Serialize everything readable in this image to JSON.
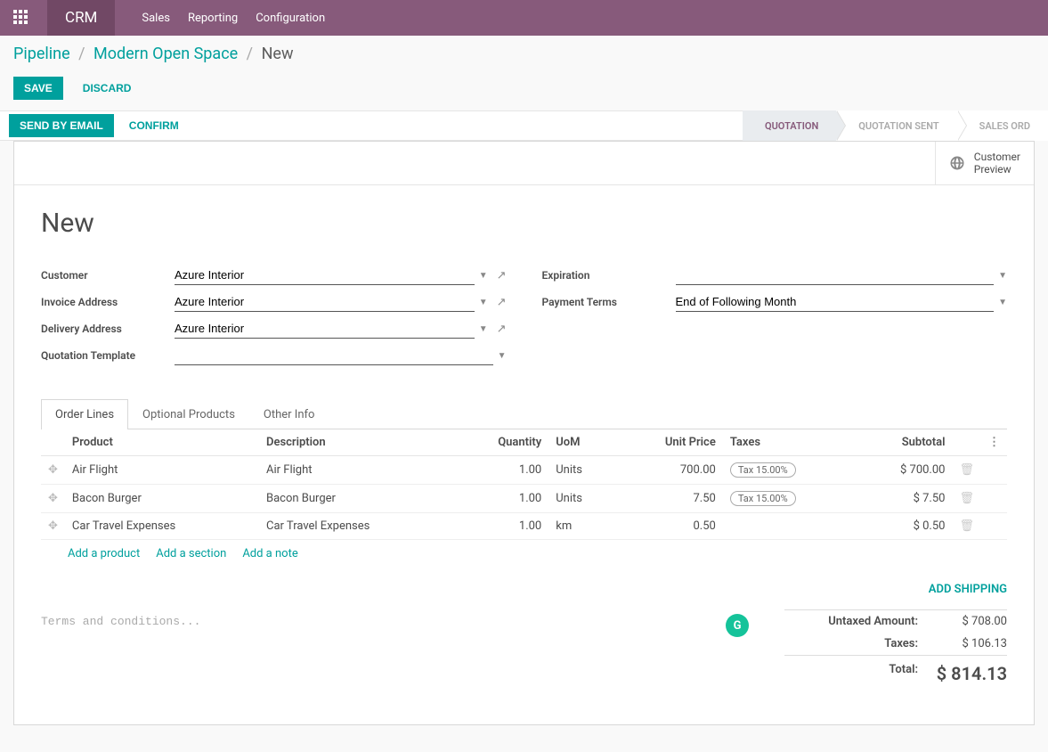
{
  "topbar": {
    "app": "CRM",
    "nav": [
      "Sales",
      "Reporting",
      "Configuration"
    ]
  },
  "breadcrumb": {
    "items": [
      "Pipeline",
      "Modern Open Space"
    ],
    "current": "New"
  },
  "actions": {
    "save": "SAVE",
    "discard": "DISCARD"
  },
  "statusbar": {
    "send": "SEND BY EMAIL",
    "confirm": "CONFIRM",
    "steps": [
      "QUOTATION",
      "QUOTATION SENT",
      "SALES ORD"
    ]
  },
  "preview": "Customer\nPreview",
  "title": "New",
  "form": {
    "customer_label": "Customer",
    "customer": "Azure Interior",
    "invoice_label": "Invoice Address",
    "invoice": "Azure Interior",
    "delivery_label": "Delivery Address",
    "delivery": "Azure Interior",
    "template_label": "Quotation Template",
    "template": "",
    "expiration_label": "Expiration",
    "expiration": "",
    "terms_label": "Payment Terms",
    "terms": "End of Following Month"
  },
  "tabs": [
    "Order Lines",
    "Optional Products",
    "Other Info"
  ],
  "columns": {
    "product": "Product",
    "description": "Description",
    "quantity": "Quantity",
    "uom": "UoM",
    "unit_price": "Unit Price",
    "taxes": "Taxes",
    "subtotal": "Subtotal"
  },
  "lines": [
    {
      "product": "Air Flight",
      "description": "Air Flight",
      "quantity": "1.00",
      "uom": "Units",
      "unit_price": "700.00",
      "tax": "Tax 15.00%",
      "subtotal": "$ 700.00"
    },
    {
      "product": "Bacon Burger",
      "description": "Bacon Burger",
      "quantity": "1.00",
      "uom": "Units",
      "unit_price": "7.50",
      "tax": "Tax 15.00%",
      "subtotal": "$ 7.50"
    },
    {
      "product": "Car Travel Expenses",
      "description": "Car Travel Expenses",
      "quantity": "1.00",
      "uom": "km",
      "unit_price": "0.50",
      "tax": "",
      "subtotal": "$ 0.50"
    }
  ],
  "add": {
    "product": "Add a product",
    "section": "Add a section",
    "note": "Add a note"
  },
  "shipping": "ADD SHIPPING",
  "terms_placeholder": "Terms and conditions...",
  "totals": {
    "untaxed_label": "Untaxed Amount:",
    "untaxed": "$ 708.00",
    "taxes_label": "Taxes:",
    "taxes": "$ 106.13",
    "total_label": "Total:",
    "total": "$ 814.13"
  }
}
